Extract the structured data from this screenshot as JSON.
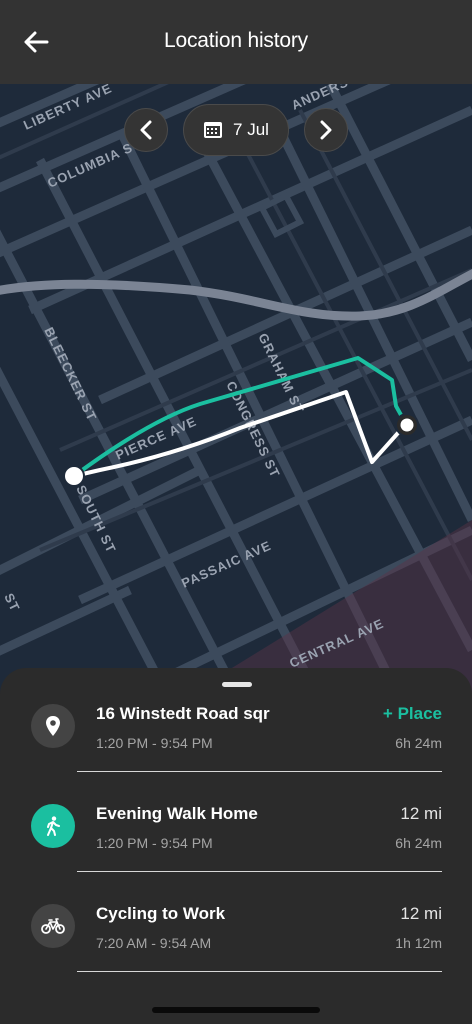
{
  "header": {
    "title": "Location history",
    "back_icon": "arrow-left-icon"
  },
  "date_nav": {
    "date_label": "7 Jul",
    "calendar_icon": "calendar-icon",
    "prev_icon": "chevron-left-icon",
    "next_icon": "chevron-right-icon"
  },
  "map": {
    "street_labels": [
      "LIBERTY AVE",
      "COLUMBIA ST",
      "ANDERSON AVE",
      "BLEECKER ST",
      "PIERCE AVE",
      "CONGRESS ST",
      "GRAHAM ST",
      "SOUTH ST",
      "PASSAIC AVE",
      "CENTRAL AVE",
      "ST"
    ],
    "route_colors": {
      "primary": "#ffffff",
      "secondary": "#1bbfa0"
    }
  },
  "sheet": {
    "items": [
      {
        "icon": "location-pin-icon",
        "title": "16 Winstedt Road sqr",
        "time": "1:20 PM - 9:54 PM",
        "right": "+ Place",
        "duration": "6h 24m"
      },
      {
        "icon": "walking-icon",
        "title": "Evening Walk Home",
        "time": "1:20 PM - 9:54 PM",
        "right": "12 mi",
        "duration": "6h 24m"
      },
      {
        "icon": "bicycle-icon",
        "title": "Cycling to Work",
        "time": "7:20 AM - 9:54 AM",
        "right": "12 mi",
        "duration": "1h 12m"
      }
    ]
  },
  "colors": {
    "accent": "#1bbfa0",
    "background": "#2b2b2b",
    "map_bg": "#1e2a3a"
  }
}
